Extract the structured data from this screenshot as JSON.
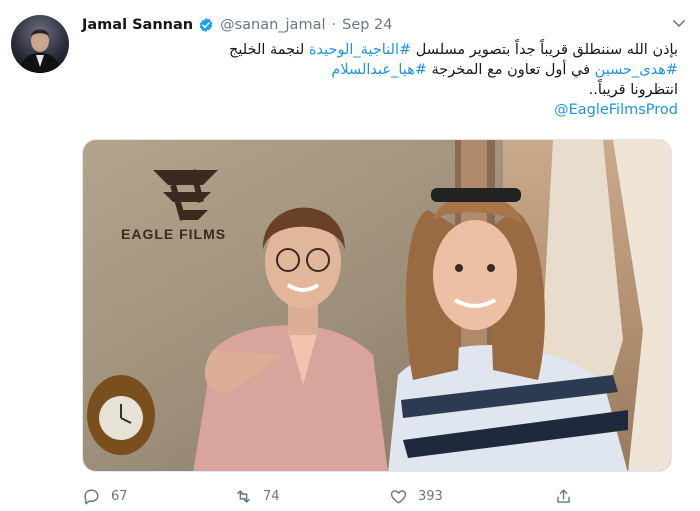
{
  "tweet": {
    "author_name": "Jamal Sannan",
    "handle": "@sanan_jamal",
    "separator": "·",
    "date": "Sep 24",
    "line1_a": "بإذن الله سننطلق قريباً جداً بتصوير مسلسل ",
    "line1_tag": "#الناجية_الوحيدة",
    "line1_b": " لنجمة الخليج",
    "line2_tag1": "#هدى_حسين",
    "line2_mid": " في أول تعاون مع المخرجة ",
    "line2_tag2": "#هيا_عبدالسلام",
    "line3": "انتظرونا قريباً..",
    "mention": "@EagleFilmsProd"
  },
  "media": {
    "logo_text": "EAGLE FILMS"
  },
  "actions": {
    "replies": "67",
    "retweets": "74",
    "likes": "393"
  },
  "icons": {
    "avatar": "user-avatar",
    "verified": "verified-badge-icon",
    "caret": "chevron-down-icon",
    "reply": "reply-icon",
    "retweet": "retweet-icon",
    "like": "heart-icon",
    "share": "share-icon"
  },
  "colors": {
    "link": "#1b95e0",
    "secondary_text": "#657786",
    "verified": "#1da1f2"
  }
}
